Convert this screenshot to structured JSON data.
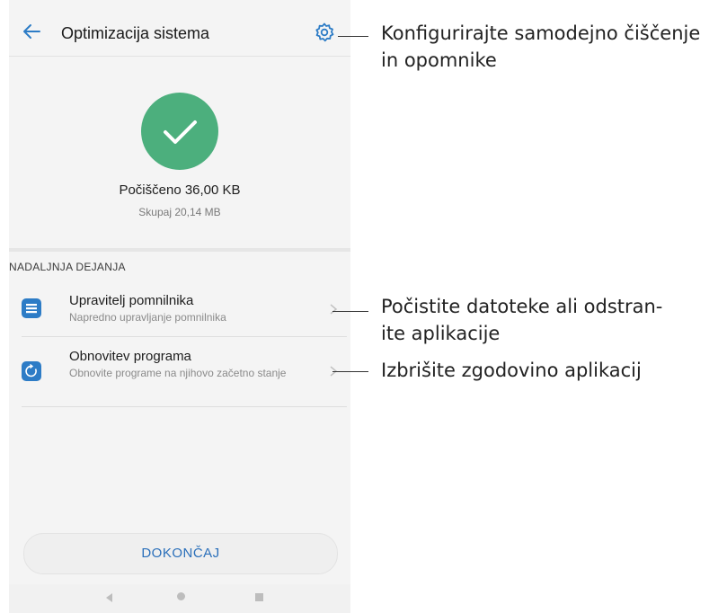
{
  "phone": {
    "title": "Optimizacija sistema",
    "cleaned": "Počiščeno 36,00 KB",
    "total": "Skupaj 20,14 MB",
    "section_header": "NADALJNJA DEJANJA",
    "items": [
      {
        "title": "Upravitelj pomnilnika",
        "subtitle": "Napredno upravljanje pomnilnika",
        "icon": "storage-manager-icon"
      },
      {
        "title": "Obnovitev programa",
        "subtitle": "Obnovite programe na njihovo začetno stanje",
        "icon": "restore-icon"
      }
    ],
    "done_label": "DOKONČAJ"
  },
  "callouts": {
    "settings": [
      "Konfigurirajte samodejno čiščenje",
      "in opomnike"
    ],
    "memory": [
      "Počistite datoteke ali odstran-",
      "ite aplikacije"
    ],
    "restore": [
      "Izbrišite zgodovino aplikacij"
    ]
  },
  "colors": {
    "accent_green": "#4caf7d",
    "accent_blue": "#2d7cc6",
    "button_text": "#2a6fba"
  }
}
